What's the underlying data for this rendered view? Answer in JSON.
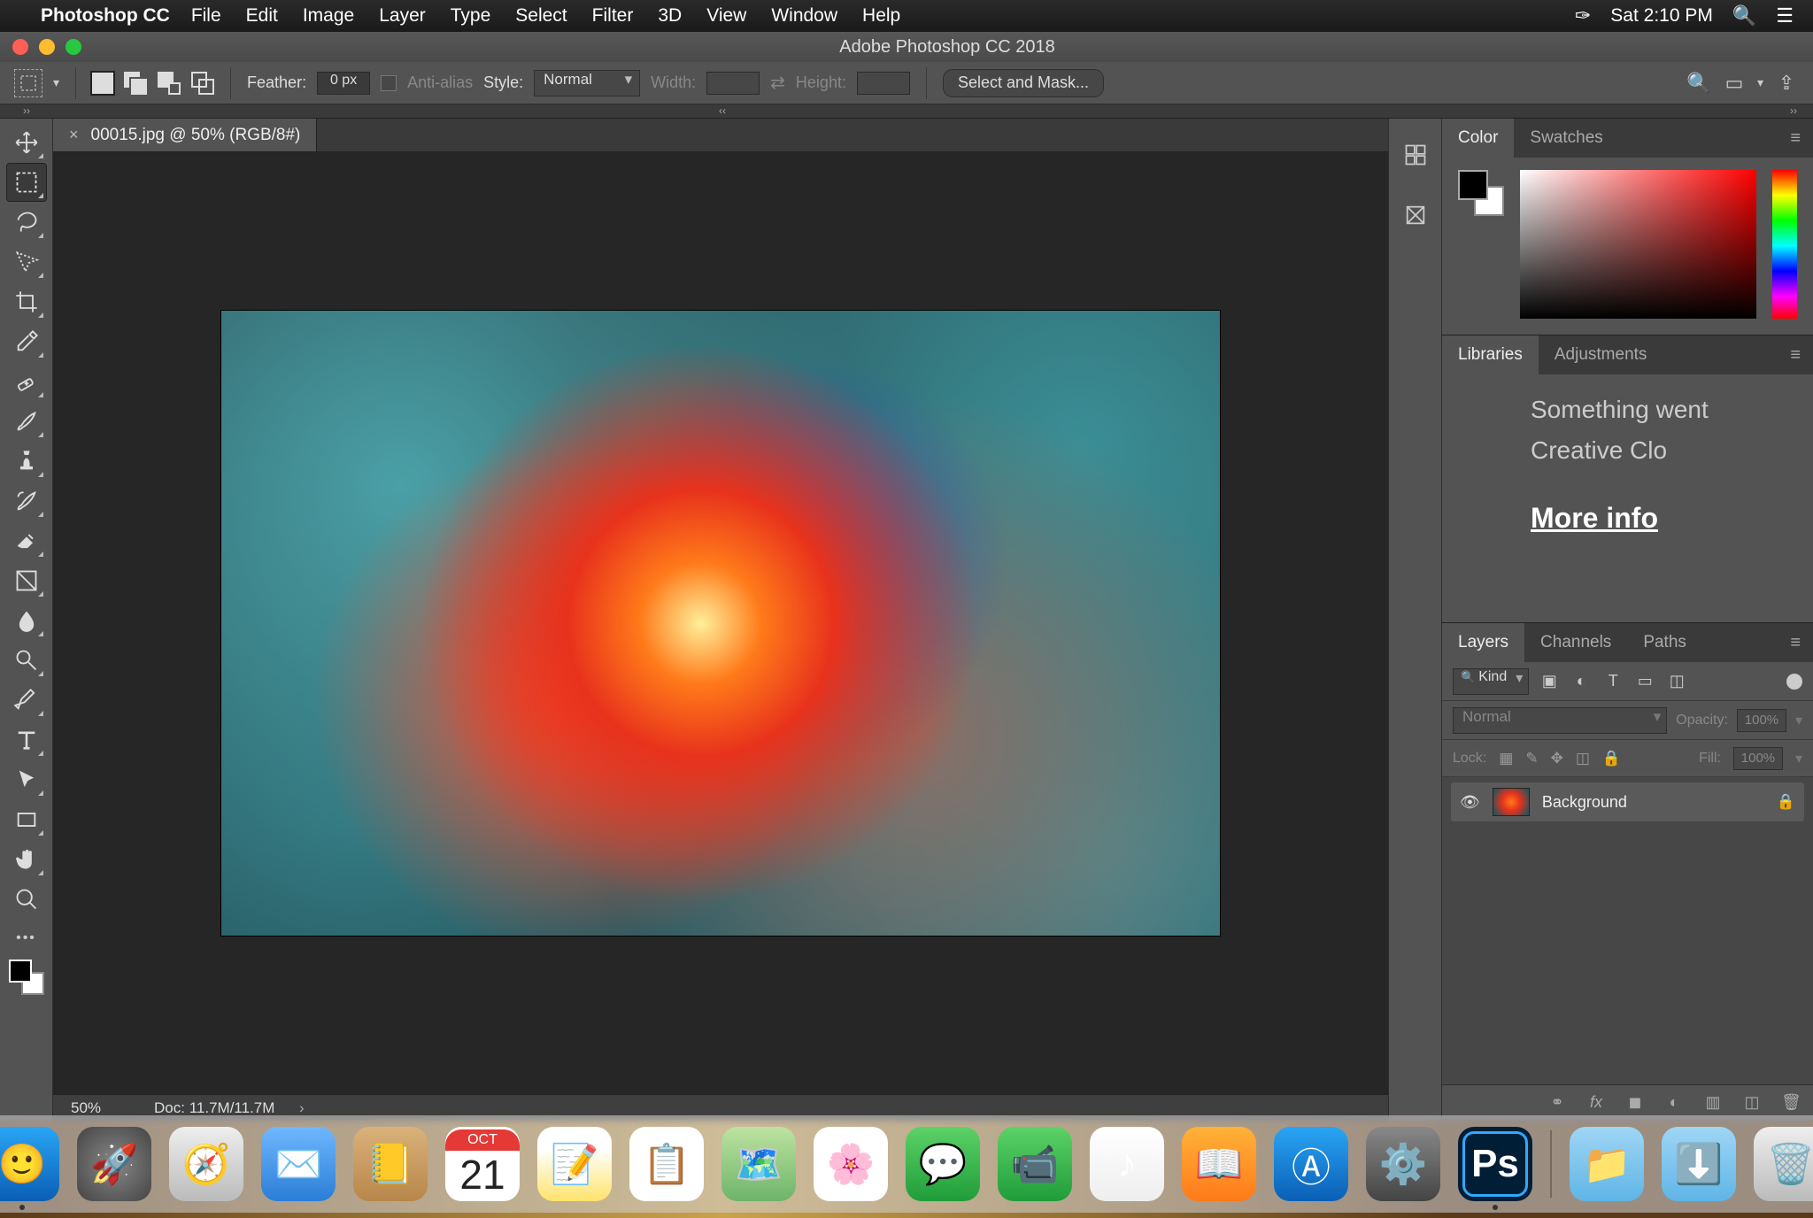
{
  "menubar": {
    "app": "Photoshop CC",
    "items": [
      "File",
      "Edit",
      "Image",
      "Layer",
      "Type",
      "Select",
      "Filter",
      "3D",
      "View",
      "Window",
      "Help"
    ],
    "datetime": "Sat 2:10 PM"
  },
  "window": {
    "title": "Adobe Photoshop CC 2018"
  },
  "options": {
    "feather_label": "Feather:",
    "feather_value": "0 px",
    "antialias_label": "Anti-alias",
    "style_label": "Style:",
    "style_value": "Normal",
    "width_label": "Width:",
    "height_label": "Height:",
    "select_mask": "Select and Mask..."
  },
  "document": {
    "tab_label": "00015.jpg @ 50% (RGB/8#)",
    "zoom": "50%",
    "docsize": "Doc: 11.7M/11.7M"
  },
  "panels": {
    "color_tab": "Color",
    "swatches_tab": "Swatches",
    "libraries_tab": "Libraries",
    "adjustments_tab": "Adjustments",
    "lib_line1": "Something went",
    "lib_line2": "Creative Clo",
    "lib_link": "More info",
    "layers_tab": "Layers",
    "channels_tab": "Channels",
    "paths_tab": "Paths"
  },
  "layers": {
    "kind": "Kind",
    "blend_mode": "Normal",
    "opacity_label": "Opacity:",
    "opacity_value": "100%",
    "lock_label": "Lock:",
    "fill_label": "Fill:",
    "fill_value": "100%",
    "items": [
      {
        "name": "Background",
        "visible": true,
        "locked": true
      }
    ]
  },
  "dock": {
    "cal_month": "OCT",
    "cal_day": "21",
    "ps_label": "Ps"
  }
}
